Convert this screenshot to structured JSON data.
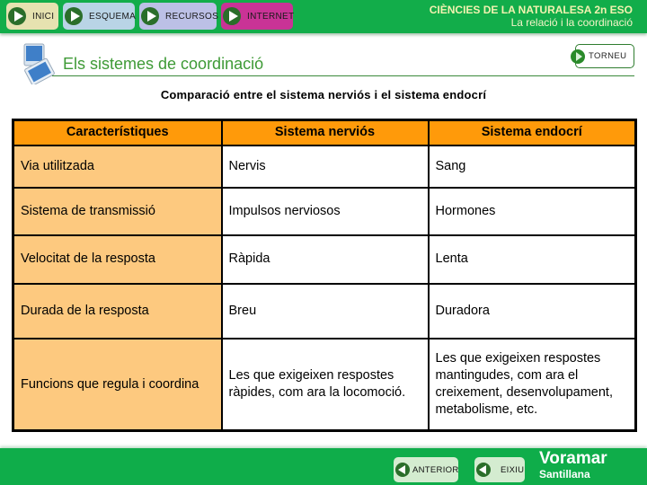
{
  "nav": {
    "buttons": [
      {
        "label": "INICI",
        "color": "#e6e2b0"
      },
      {
        "label": "ESQUEMA",
        "color": "#b9d4e6"
      },
      {
        "label": "RECURSOS",
        "color": "#bcc0e6"
      },
      {
        "label": "INTERNET",
        "color": "#c93396"
      }
    ]
  },
  "course": {
    "title": "CIÈNCIES DE LA NATURALESA 2n ESO",
    "unit": "La relació i la coordinació"
  },
  "section": {
    "title": "Els sistemes de coordinació",
    "back_label": "TORNEU"
  },
  "subtitle": "Comparació entre el sistema nerviós i el sistema endocrí",
  "table": {
    "headers": [
      "Característiques",
      "Sistema nerviós",
      "Sistema endocrí"
    ],
    "rows": [
      [
        "Via utilitzada",
        "Nervis",
        "Sang"
      ],
      [
        "Sistema de transmissió",
        "Impulsos nerviosos",
        "Hormones"
      ],
      [
        "Velocitat de la resposta",
        "Ràpida",
        "Lenta"
      ],
      [
        "Durada de la resposta",
        "Breu",
        "Duradora"
      ],
      [
        "Funcions que regula i coordina",
        "Les que exigeixen respostes ràpides, com ara la locomoció.",
        "Les que exigeixen respostes mantingudes, com ara el creixement, desenvolupament, metabolisme, etc."
      ]
    ]
  },
  "footer": {
    "prev_label": "ANTERIOR",
    "exit_label": "EIXIU",
    "brand": "Voramar",
    "publisher": "Santillana"
  },
  "colors": {
    "header_green": "#12ad4a",
    "table_header": "#ff9a0a",
    "feature_cell": "#fdc97f",
    "section_title": "#3e9a36"
  }
}
